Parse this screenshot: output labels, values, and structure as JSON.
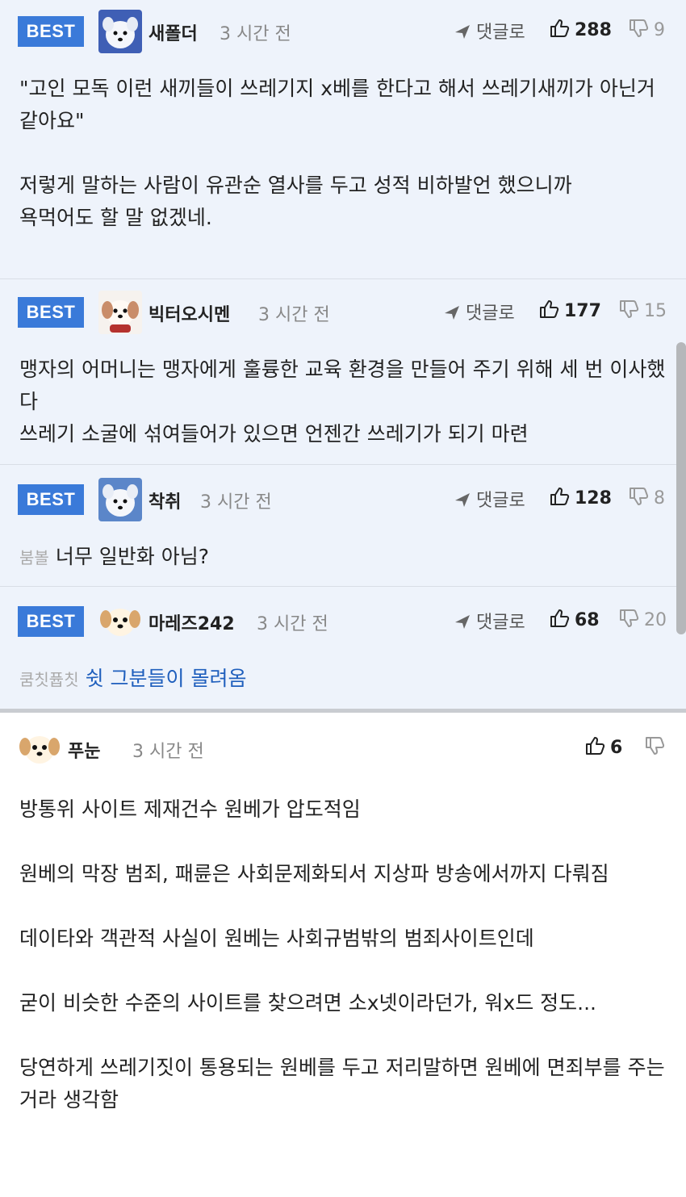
{
  "best_comments": [
    {
      "badge": "BEST",
      "nickname": "새폴더",
      "time": "3 시간 전",
      "reply_label": "댓글로",
      "upvotes": "288",
      "downvotes": "9",
      "body": "\"고인 모독 이런 새끼들이 쓰레기지 x베를 한다고 해서 쓰레기새끼가 아닌거 같아요\"\n\n저렇게 말하는 사람이 유관순 열사를 두고 성적 비하발언 했으니까\n욕먹어도 할 말 없겠네."
    },
    {
      "badge": "BEST",
      "nickname": "빅터오시멘",
      "time": "3 시간 전",
      "reply_label": "댓글로",
      "upvotes": "177",
      "downvotes": "15",
      "body": "맹자의 어머니는 맹자에게 훌륭한 교육 환경을 만들어 주기 위해 세 번 이사했다\n쓰레기 소굴에 섞여들어가 있으면 언젠간 쓰레기가 되기 마련"
    },
    {
      "badge": "BEST",
      "nickname": "착취",
      "time": "3 시간 전",
      "reply_label": "댓글로",
      "upvotes": "128",
      "downvotes": "8",
      "tag": "붐볼",
      "body": "너무 일반화 아님?"
    },
    {
      "badge": "BEST",
      "nickname": "마레즈242",
      "time": "3 시간 전",
      "reply_label": "댓글로",
      "upvotes": "68",
      "downvotes": "20",
      "tag": "쿰칫퓹칫",
      "body": "쉿 그분들이 몰려옴"
    }
  ],
  "comment": {
    "nickname": "푸눈",
    "time": "3 시간 전",
    "upvotes": "6",
    "body": "방통위 사이트 제재건수 원베가 압도적임\n\n원베의 막장 범죄, 패륜은 사회문제화되서 지상파 방송에서까지 다뤄짐\n\n데이타와 객관적 사실이 원베는 사회규범밖의 범죄사이트인데\n\n굳이 비슷한 수준의 사이트를 찾으려면 소x넷이라던가, 워x드 정도...\n\n당연하게 쓰레기짓이 통용되는 원베를 두고 저리말하면 원베에 면죄부를 주는 거라 생각함"
  },
  "colors": {
    "best_background": "#eef3fb",
    "badge": "#3a7ad9",
    "link": "#1f5fbd"
  },
  "icons": {
    "reply": "reply-arrow-icon",
    "up": "thumbs-up-icon",
    "down": "thumbs-down-icon",
    "avatar": "dog-avatar-icon"
  }
}
